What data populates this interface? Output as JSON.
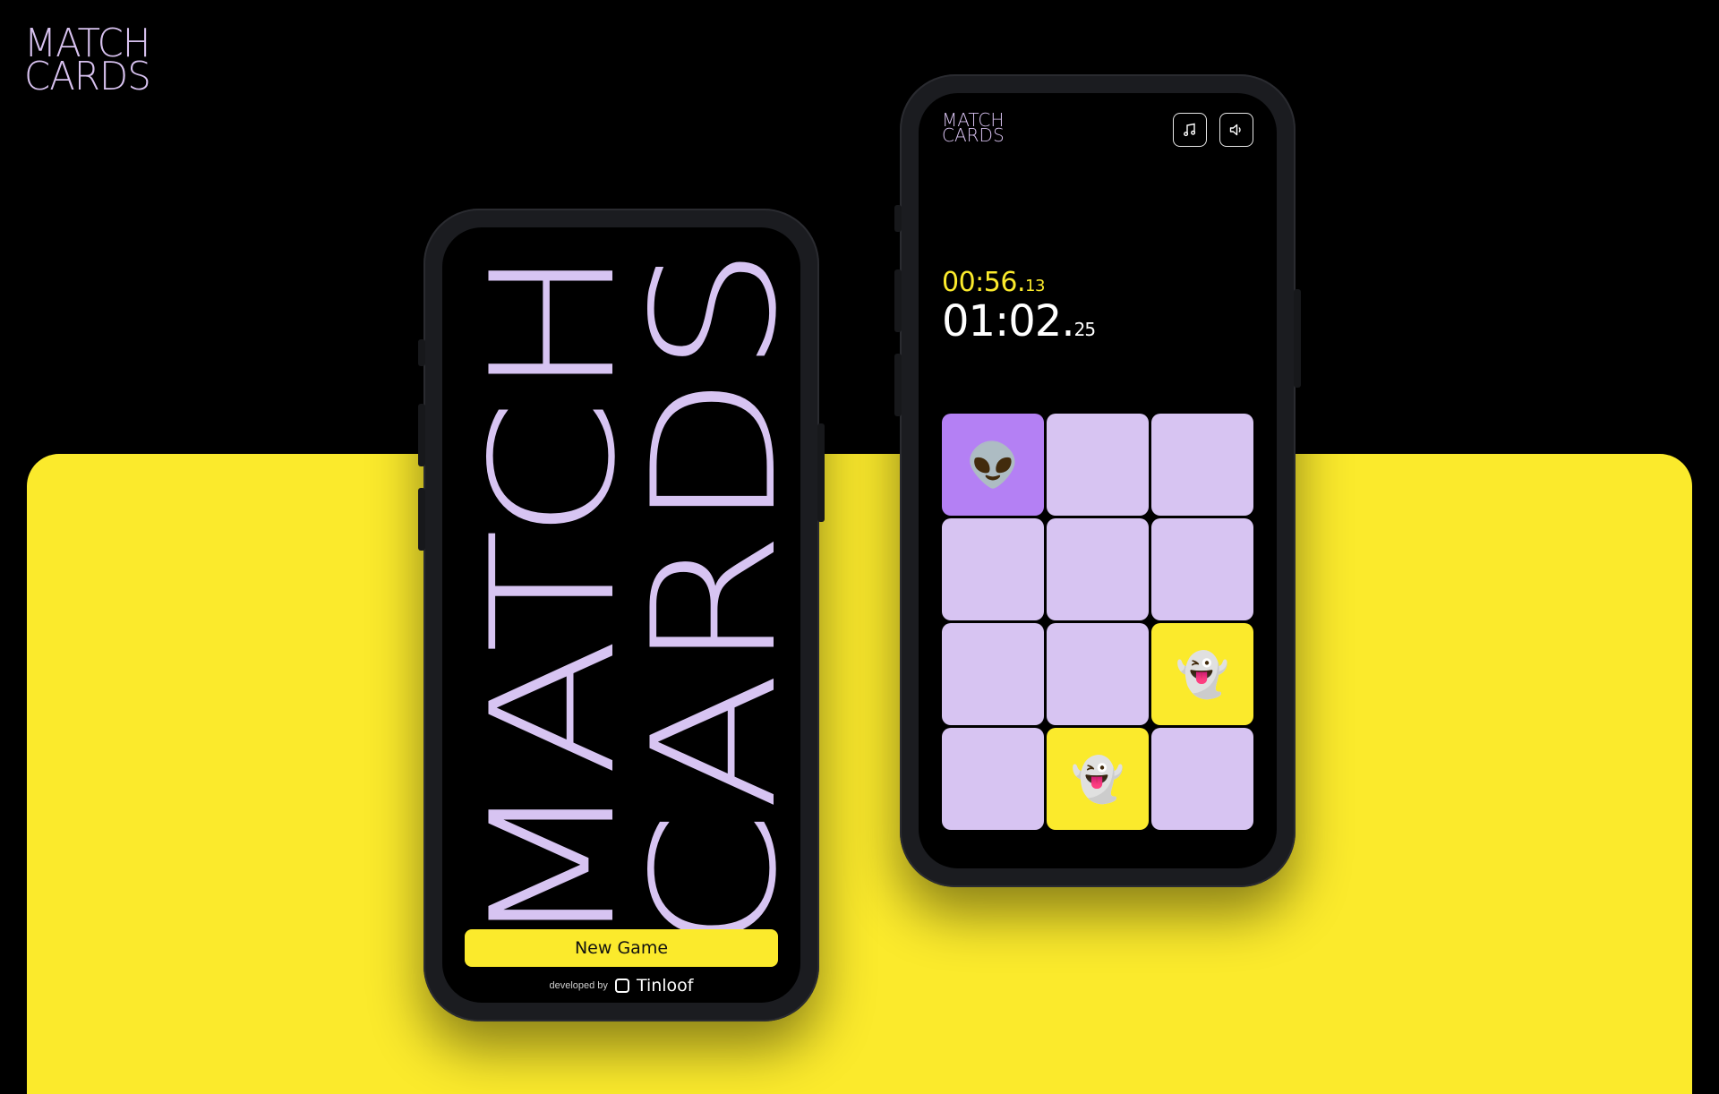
{
  "brand": {
    "line1": "MATCH",
    "line2": "CARDS"
  },
  "title_screen": {
    "title_word1": "MATCH",
    "title_word2": "CARDS",
    "new_game_label": "New Game",
    "developed_by_label": "developed by",
    "developer_name": "Tinloof"
  },
  "game_screen": {
    "logo_line1": "MATCH",
    "logo_line2": "CARDS",
    "music_icon": "music-note-icon",
    "sound_icon": "speaker-icon",
    "best_time_main": "00:56.",
    "best_time_frac": "13",
    "current_time_main": "01:02.",
    "current_time_frac": "25",
    "cards": [
      {
        "state": "active",
        "emoji": "👽"
      },
      {
        "state": "hidden",
        "emoji": ""
      },
      {
        "state": "hidden",
        "emoji": ""
      },
      {
        "state": "hidden",
        "emoji": ""
      },
      {
        "state": "hidden",
        "emoji": ""
      },
      {
        "state": "hidden",
        "emoji": ""
      },
      {
        "state": "hidden",
        "emoji": ""
      },
      {
        "state": "hidden",
        "emoji": ""
      },
      {
        "state": "matched",
        "emoji": "👻"
      },
      {
        "state": "hidden",
        "emoji": ""
      },
      {
        "state": "matched",
        "emoji": "👻"
      },
      {
        "state": "hidden",
        "emoji": ""
      }
    ]
  },
  "colors": {
    "lavender": "#d7c4f2",
    "purple_active": "#b480f4",
    "yellow": "#fbea2c",
    "black": "#000000"
  }
}
